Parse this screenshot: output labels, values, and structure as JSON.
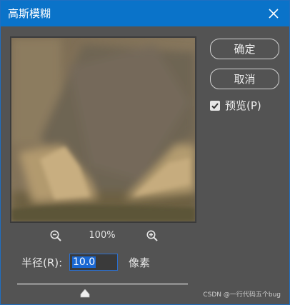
{
  "dialog": {
    "title": "高斯模糊",
    "close_icon": "close-icon"
  },
  "buttons": {
    "ok_label": "确定",
    "cancel_label": "取消"
  },
  "preview_toggle": {
    "label": "预览(P)",
    "checked": true
  },
  "zoom": {
    "out_icon": "zoom-out-icon",
    "level": "100%",
    "in_icon": "zoom-in-icon"
  },
  "radius": {
    "label": "半径(R):",
    "value": "10.0",
    "unit": "像素"
  },
  "slider": {
    "icon": "slider-thumb-icon"
  },
  "watermark": "CSDN @一行代码五个bug",
  "colors": {
    "title_bar": "#0a73c9",
    "dialog_bg": "#535353",
    "selection": "#1967d2"
  }
}
